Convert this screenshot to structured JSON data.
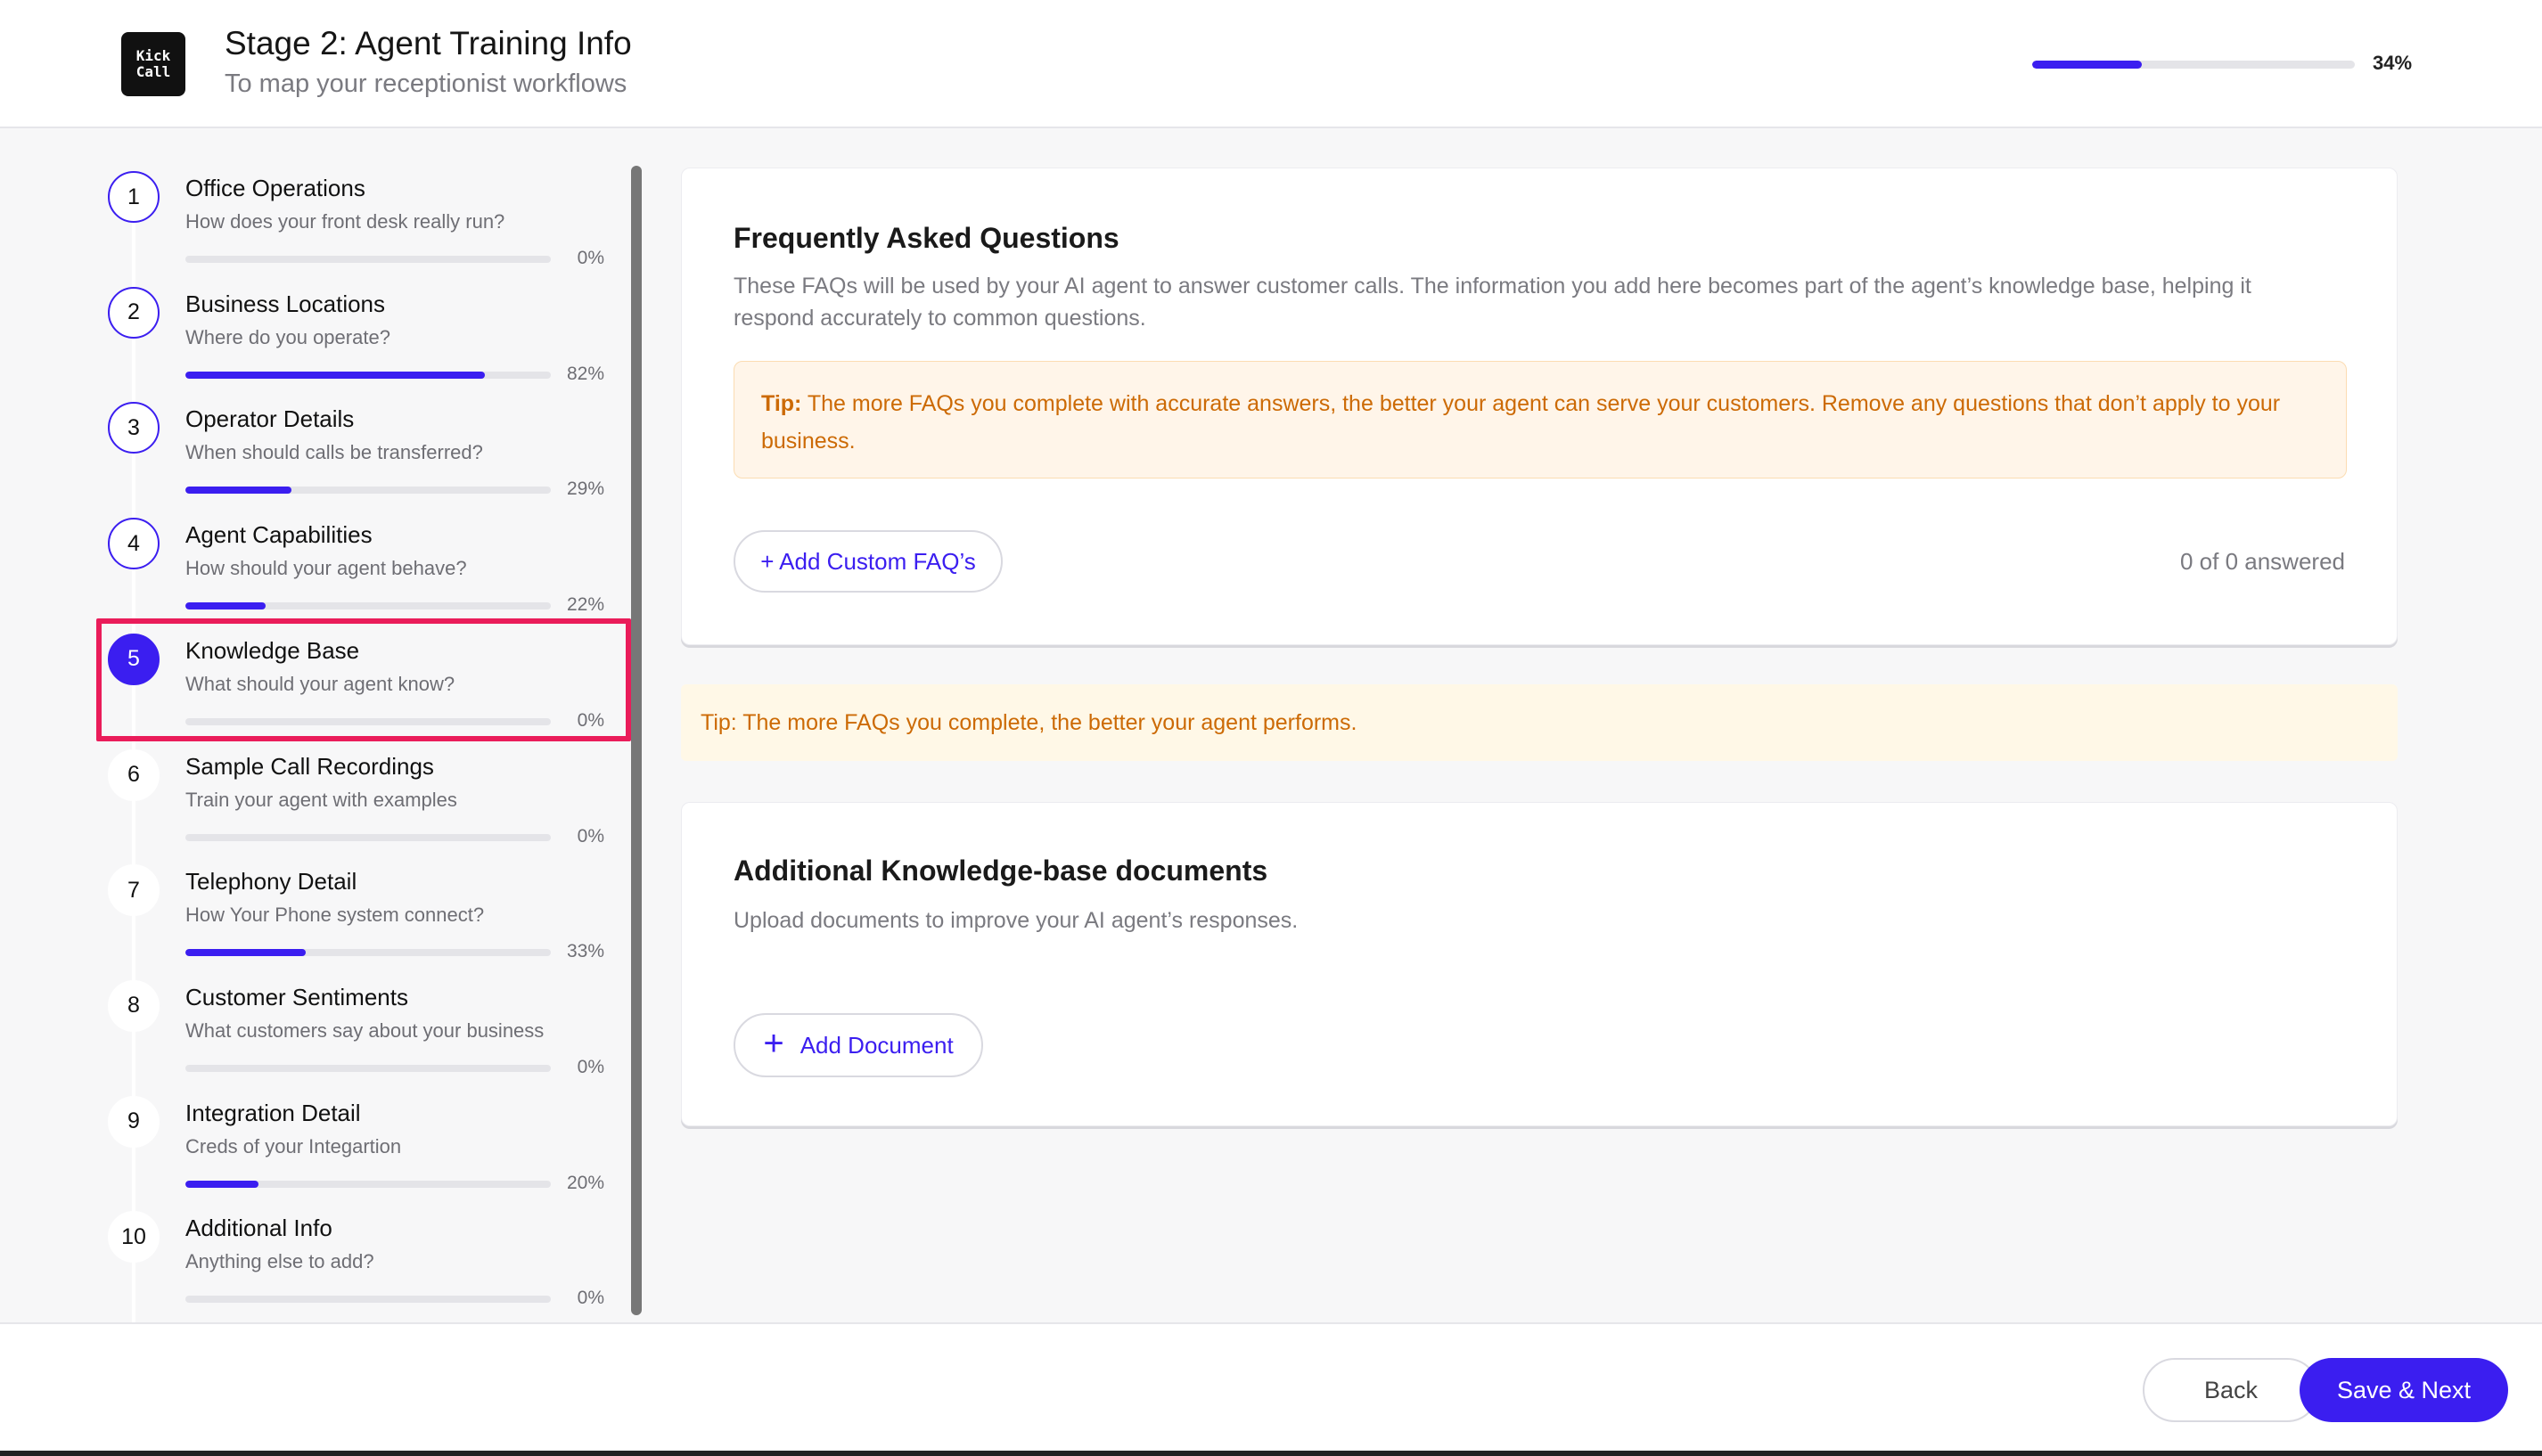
{
  "header": {
    "logo_line1": "Kick",
    "logo_line2": "Call",
    "title": "Stage 2: Agent Training Info",
    "subtitle": "To map your receptionist workflows",
    "progress_percent": 34,
    "progress_label": "34%"
  },
  "sidebar": {
    "steps": [
      {
        "number": "1",
        "title": "Office Operations",
        "desc": "How does your front desk really run?",
        "progress": 0,
        "pct": "0%",
        "state": "outlined"
      },
      {
        "number": "2",
        "title": "Business Locations",
        "desc": "Where do you operate?",
        "progress": 82,
        "pct": "82%",
        "state": "outlined"
      },
      {
        "number": "3",
        "title": "Operator Details",
        "desc": "When should calls be transferred?",
        "progress": 29,
        "pct": "29%",
        "state": "outlined"
      },
      {
        "number": "4",
        "title": "Agent Capabilities",
        "desc": "How should your agent behave?",
        "progress": 22,
        "pct": "22%",
        "state": "outlined"
      },
      {
        "number": "5",
        "title": "Knowledge Base",
        "desc": "What should your agent know?",
        "progress": 0,
        "pct": "0%",
        "state": "active"
      },
      {
        "number": "6",
        "title": "Sample Call Recordings",
        "desc": "Train your agent with examples",
        "progress": 0,
        "pct": "0%",
        "state": "plain"
      },
      {
        "number": "7",
        "title": "Telephony Detail",
        "desc": "How Your Phone system connect?",
        "progress": 33,
        "pct": "33%",
        "state": "plain"
      },
      {
        "number": "8",
        "title": "Customer Sentiments",
        "desc": "What customers say about your business",
        "progress": 0,
        "pct": "0%",
        "state": "plain"
      },
      {
        "number": "9",
        "title": "Integration Detail",
        "desc": "Creds of your Integartion",
        "progress": 20,
        "pct": "20%",
        "state": "plain"
      },
      {
        "number": "10",
        "title": "Additional Info",
        "desc": "Anything else to add?",
        "progress": 0,
        "pct": "0%",
        "state": "plain"
      }
    ]
  },
  "faq": {
    "title": "Frequently Asked Questions",
    "description": "These FAQs will be used by your AI agent to answer customer calls. The information you add here becomes part of the agent’s knowledge base, helping it respond accurately to common questions.",
    "tip_label": "Tip:",
    "tip_text": " The more FAQs you complete with accurate answers, the better your agent can serve your customers. Remove any questions that don’t apply to your business.",
    "add_button": "+ Add Custom FAQ’s",
    "answered": "0 of 0 answered"
  },
  "tip_banner": "Tip: The more FAQs you complete, the better your agent performs.",
  "documents": {
    "title": "Additional Knowledge-base documents",
    "description": "Upload documents to improve your AI agent’s responses.",
    "add_button": "Add Document"
  },
  "footer": {
    "back": "Back",
    "next": "Save & Next"
  },
  "colors": {
    "accent": "#3b1ef0",
    "highlight": "#ea1c5a",
    "tip_text": "#cc6a05"
  }
}
